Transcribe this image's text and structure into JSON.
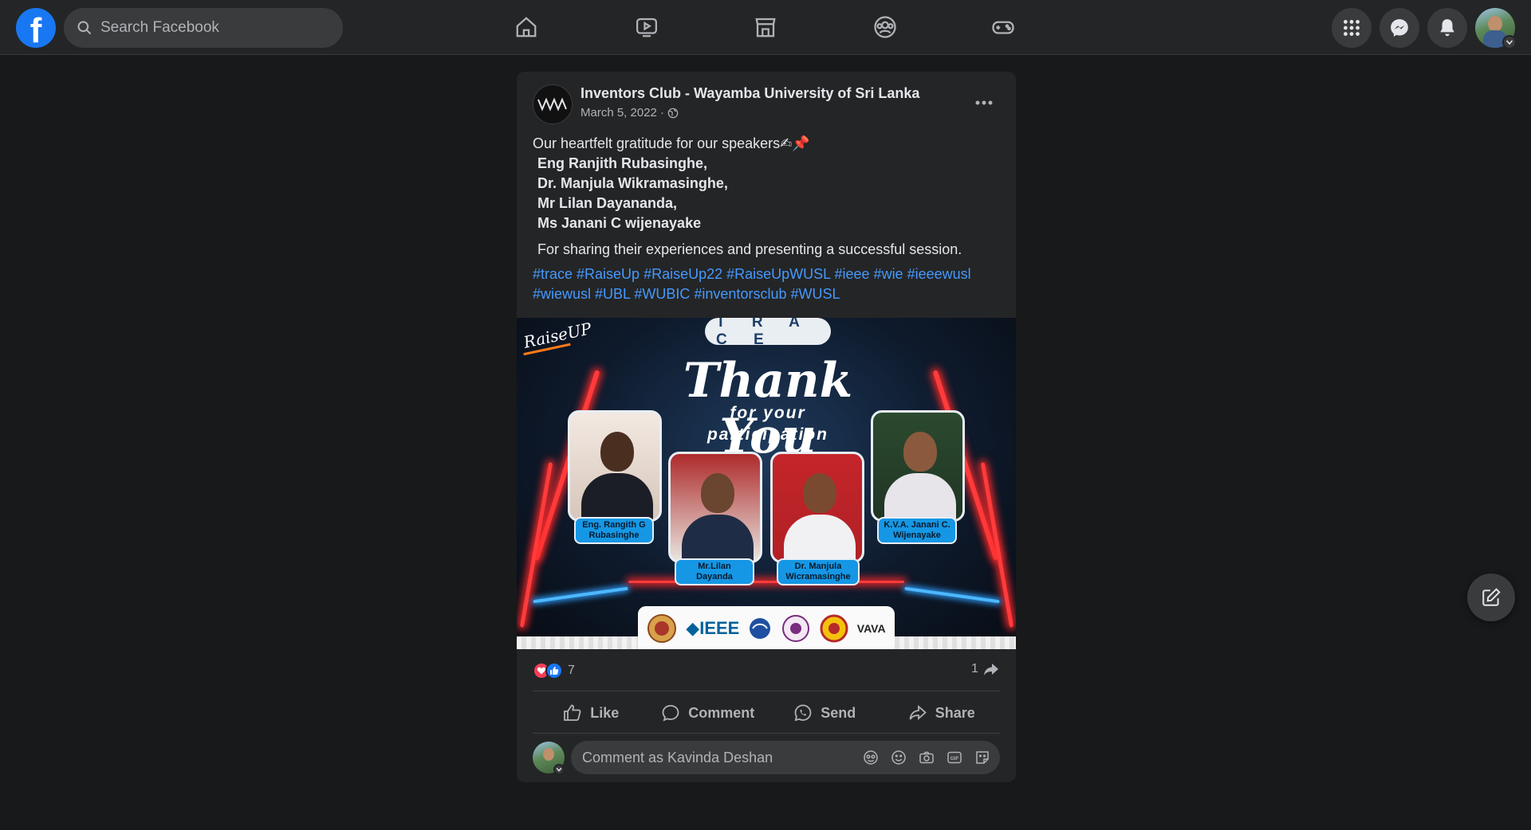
{
  "topbar": {
    "logo_letter": "f",
    "search_placeholder": "Search Facebook",
    "nav": [
      "home-icon",
      "watch-icon",
      "marketplace-icon",
      "groups-icon",
      "gaming-icon"
    ],
    "right": [
      "menu-grid-icon",
      "messenger-icon",
      "notifications-icon"
    ]
  },
  "post": {
    "author": "Inventors Club - Wayamba University of Sri Lanka",
    "date": "March 5, 2022 ·",
    "audience_icon": "globe-icon",
    "intro": "Our heartfelt gratitude for our speakers✍📌",
    "speakers": [
      "Eng Ranjith Rubasinghe,",
      "Dr. Manjula Wikramasinghe,",
      "Mr Lilan Dayananda,",
      "Ms Janani  C wijenayake"
    ],
    "closing": "For sharing their experiences and presenting a successful session.",
    "hashtags_line1": "#trace #RaiseUp #RaiseUp22 #RaiseUpWUSL #ieee #wie #ieeewusl",
    "hashtags_line2": "#wiewusl #UBL #WUBIC #inventorsclub #WUSL",
    "image": {
      "badge": "T R A C E",
      "brand": "RaiseUP",
      "headline": "Thank You",
      "subline1": "for your",
      "subline2": "participation",
      "tags": [
        {
          "line1": "Eng. Rangith G",
          "line2": "Rubasinghe"
        },
        {
          "line1": "Mr.Lilan",
          "line2": "Dayanda"
        },
        {
          "line1": "Dr. Manjula",
          "line2": "Wicramasinghe"
        },
        {
          "line1": "K.V.A. Janani C.",
          "line2": "Wijenayake"
        }
      ],
      "sponsor_ieee": "IEEE",
      "sponsor_club": "VAVA"
    },
    "reaction_count": "7",
    "share_count": "1",
    "actions": {
      "like": "Like",
      "comment": "Comment",
      "send": "Send",
      "share": "Share"
    },
    "comment_placeholder": "Comment as Kavinda Deshan"
  }
}
